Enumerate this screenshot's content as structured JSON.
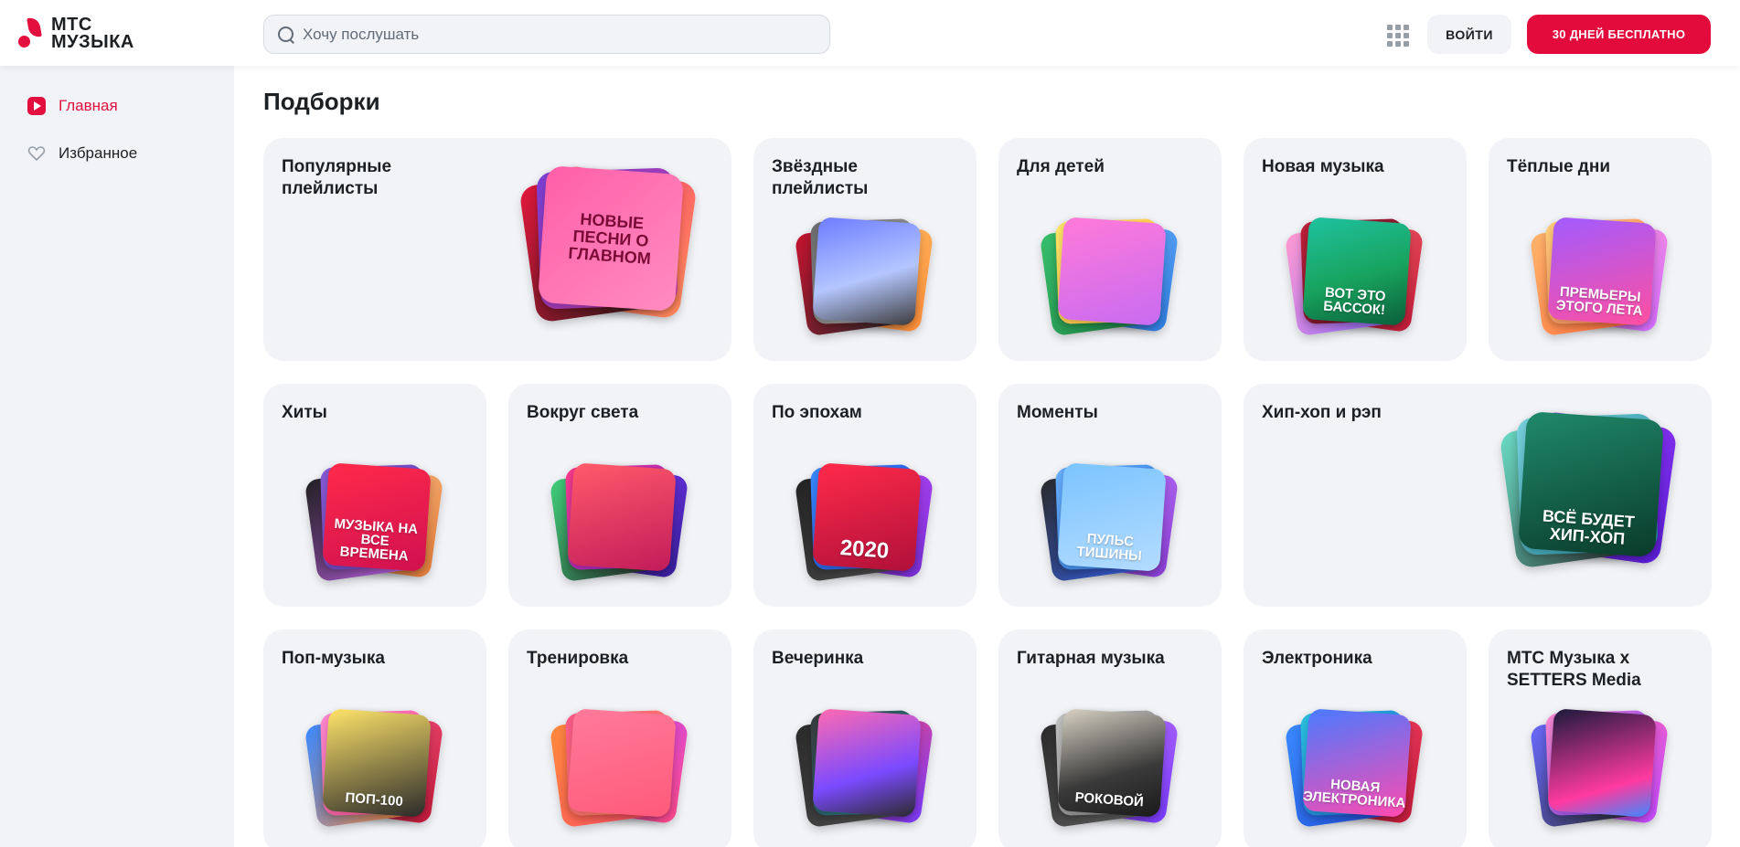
{
  "header": {
    "logo_line1": "МТС",
    "logo_line2": "МУЗЫКА",
    "search_placeholder": "Хочу послушать",
    "login_label": "ВОЙТИ",
    "trial_label": "30 ДНЕЙ БЕСПЛАТНО"
  },
  "sidebar": {
    "items": [
      {
        "label": "Главная",
        "icon": "home-play-icon",
        "active": true
      },
      {
        "label": "Избранное",
        "icon": "heart-icon",
        "active": false
      }
    ]
  },
  "main": {
    "section_title": "Подборки",
    "cards": [
      {
        "title": "Популярные плейлисты",
        "cover_text": "НОВЫЕ ПЕСНИ О ГЛАВНОМ"
      },
      {
        "title": "Звёздные плейлисты",
        "cover_text": ""
      },
      {
        "title": "Для детей",
        "cover_text": ""
      },
      {
        "title": "Новая музыка",
        "cover_text": "ВОТ ЭТО БАССОК!"
      },
      {
        "title": "Тёплые дни",
        "cover_text": "ПРЕМЬЕРЫ ЭТОГО ЛЕТА"
      },
      {
        "title": "Хиты",
        "cover_text": "МУЗЫКА НА ВСЕ ВРЕМЕНА"
      },
      {
        "title": "Вокруг света",
        "cover_text": ""
      },
      {
        "title": "По эпохам",
        "cover_text": "2020"
      },
      {
        "title": "Моменты",
        "cover_text": "ПУЛЬС ТИШИНЫ"
      },
      {
        "title": "Хип-хоп и рэп",
        "cover_text": "ВСЁ БУДЕТ ХИП-ХОП"
      },
      {
        "title": "Поп-музыка",
        "cover_text": "ПОП-100"
      },
      {
        "title": "Тренировка",
        "cover_text": ""
      },
      {
        "title": "Вечеринка",
        "cover_text": ""
      },
      {
        "title": "Гитарная музыка",
        "cover_text": "РОКОВОЙ"
      },
      {
        "title": "Электроника",
        "cover_text": "НОВАЯ ЭЛЕКТРОНИКА"
      },
      {
        "title": "МТС Музыка x SETTERS Media",
        "cover_text": ""
      }
    ]
  },
  "colors": {
    "accent": "#e30f3f",
    "card_bg": "#f2f3f7",
    "sidebar_bg": "#f2f3f7"
  }
}
